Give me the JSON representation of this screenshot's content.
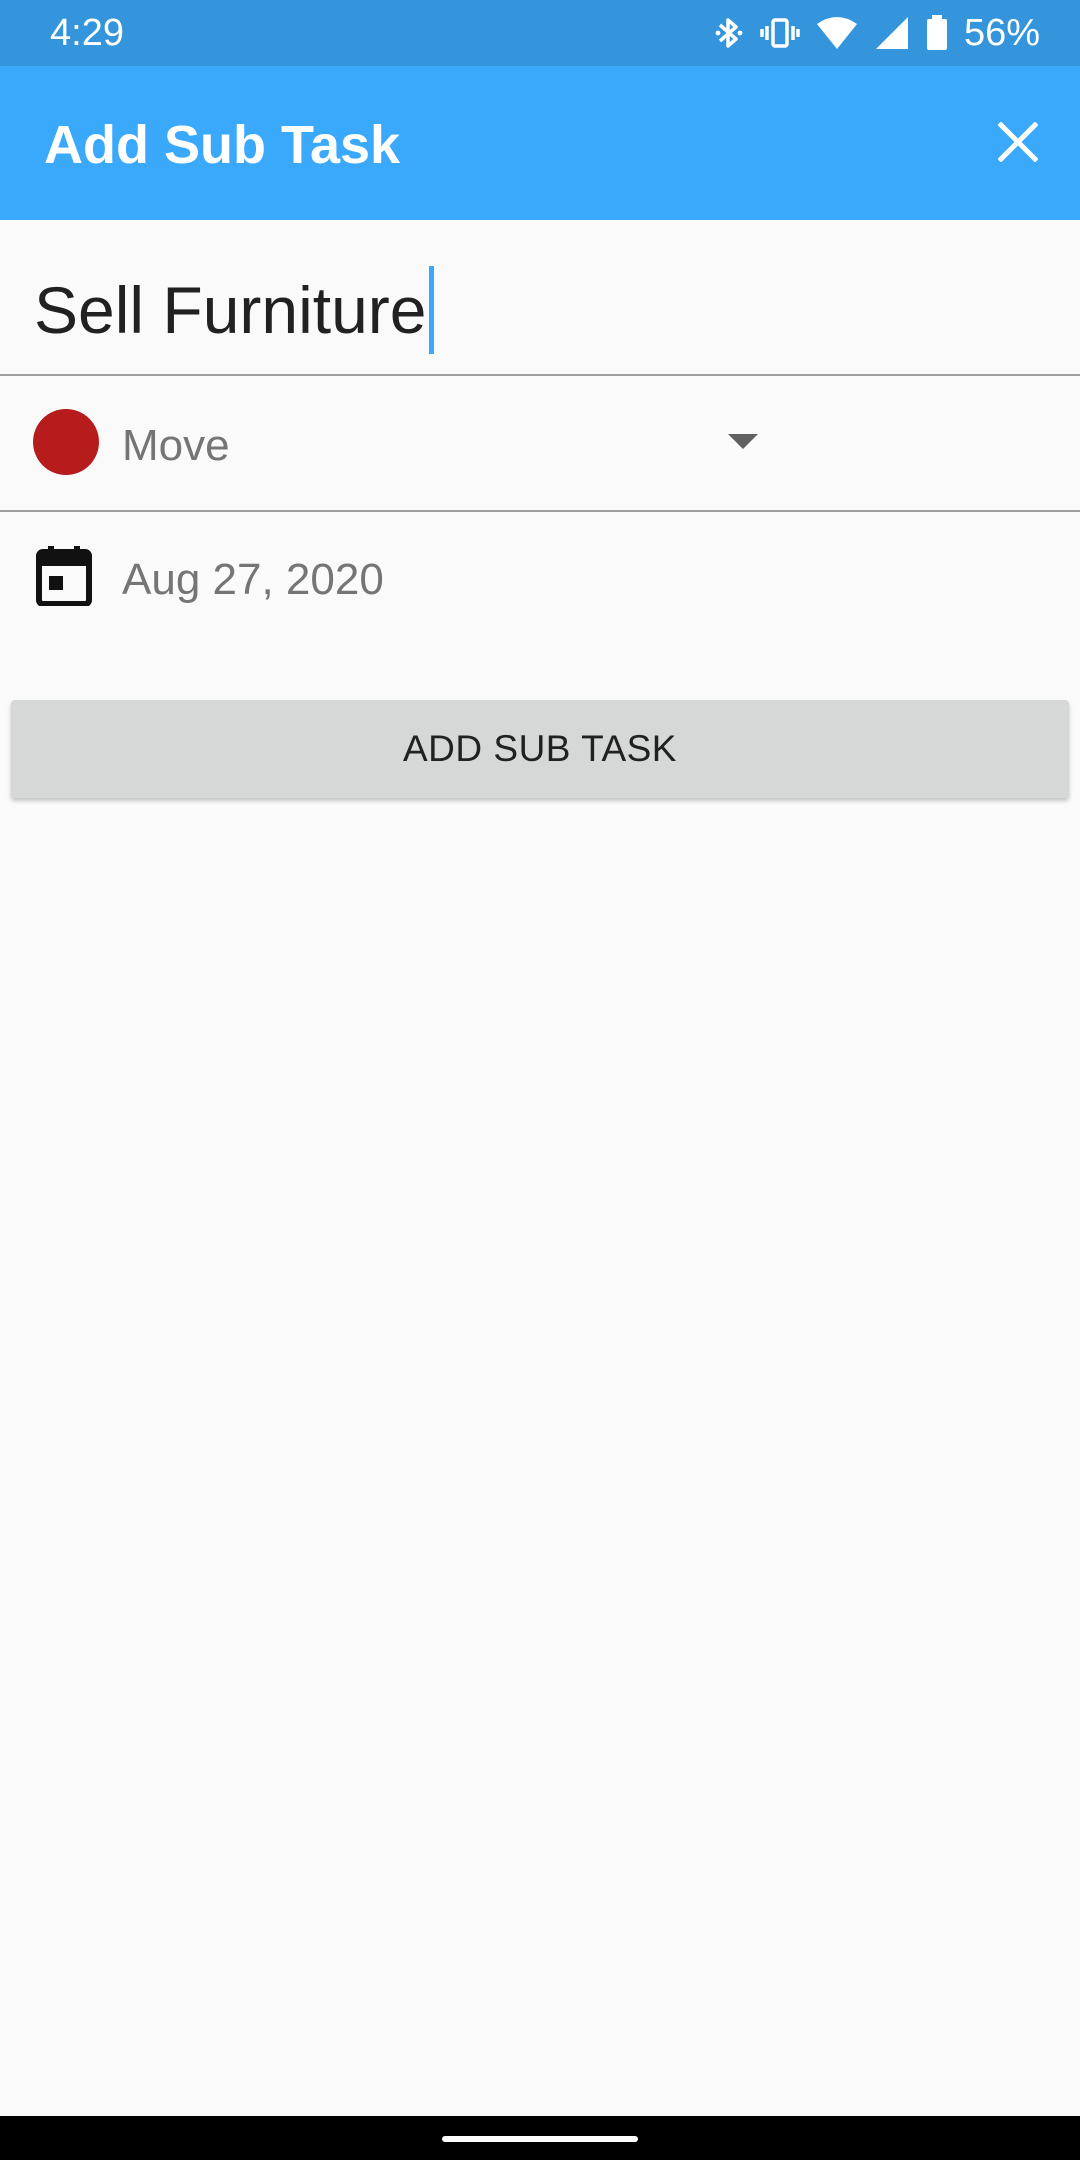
{
  "status_bar": {
    "time": "4:29",
    "battery_percent": "56%",
    "icons": [
      "bluetooth-icon",
      "vibrate-icon",
      "wifi-icon",
      "cell-signal-icon",
      "battery-icon"
    ]
  },
  "app_bar": {
    "title": "Add Sub Task",
    "close_icon": "close-icon"
  },
  "form": {
    "task_name_value": "Sell Furniture",
    "project": {
      "label": "Move",
      "color": "#b71c1c"
    },
    "due_date": "Aug 27, 2020",
    "submit_label": "ADD SUB TASK"
  },
  "colors": {
    "status_bar": "#3494dc",
    "app_bar": "#3aa9fc",
    "background": "#fafafa",
    "button": "#d6d7d7"
  }
}
